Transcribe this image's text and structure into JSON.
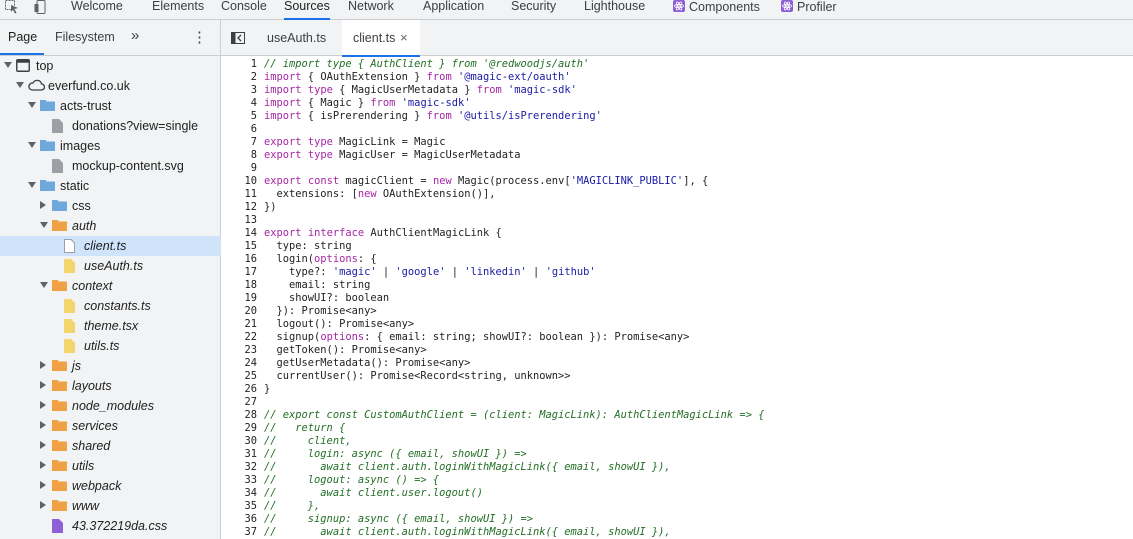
{
  "devtools_tabs": [
    "Welcome",
    "Elements",
    "Console",
    "Sources",
    "Network",
    "Application",
    "Security",
    "Lighthouse",
    "Components",
    "Profiler"
  ],
  "active_tab": "Sources",
  "navigator": {
    "tabs": [
      "Page",
      "Filesystem"
    ],
    "more": "»",
    "menu": "⋮",
    "tree": [
      {
        "label": "top",
        "depth": 0,
        "arrow": "down",
        "icon": "frame",
        "italic": false
      },
      {
        "label": "everfund.co.uk",
        "depth": 1,
        "arrow": "down",
        "icon": "cloud",
        "italic": false
      },
      {
        "label": "acts-trust",
        "depth": 2,
        "arrow": "down",
        "icon": "folder-blue",
        "italic": false
      },
      {
        "label": "donations?view=single",
        "depth": 3,
        "arrow": "",
        "icon": "file-gray",
        "italic": false
      },
      {
        "label": "images",
        "depth": 2,
        "arrow": "down",
        "icon": "folder-blue",
        "italic": false
      },
      {
        "label": "mockup-content.svg",
        "depth": 3,
        "arrow": "",
        "icon": "file-gray",
        "italic": false
      },
      {
        "label": "static",
        "depth": 2,
        "arrow": "down",
        "icon": "folder-blue",
        "italic": false
      },
      {
        "label": "css",
        "depth": 3,
        "arrow": "right",
        "icon": "folder-blue",
        "italic": false
      },
      {
        "label": "auth",
        "depth": 3,
        "arrow": "down",
        "icon": "folder-orange",
        "italic": true
      },
      {
        "label": "client.ts",
        "depth": 4,
        "arrow": "",
        "icon": "file-white",
        "italic": true,
        "selected": true
      },
      {
        "label": "useAuth.ts",
        "depth": 4,
        "arrow": "",
        "icon": "file-yellow",
        "italic": true
      },
      {
        "label": "context",
        "depth": 3,
        "arrow": "down",
        "icon": "folder-orange",
        "italic": true
      },
      {
        "label": "constants.ts",
        "depth": 4,
        "arrow": "",
        "icon": "file-yellow",
        "italic": true
      },
      {
        "label": "theme.tsx",
        "depth": 4,
        "arrow": "",
        "icon": "file-yellow",
        "italic": true
      },
      {
        "label": "utils.ts",
        "depth": 4,
        "arrow": "",
        "icon": "file-yellow",
        "italic": true
      },
      {
        "label": "js",
        "depth": 3,
        "arrow": "right",
        "icon": "folder-orange",
        "italic": true
      },
      {
        "label": "layouts",
        "depth": 3,
        "arrow": "right",
        "icon": "folder-orange",
        "italic": true
      },
      {
        "label": "node_modules",
        "depth": 3,
        "arrow": "right",
        "icon": "folder-orange",
        "italic": true
      },
      {
        "label": "services",
        "depth": 3,
        "arrow": "right",
        "icon": "folder-orange",
        "italic": true
      },
      {
        "label": "shared",
        "depth": 3,
        "arrow": "right",
        "icon": "folder-orange",
        "italic": true
      },
      {
        "label": "utils",
        "depth": 3,
        "arrow": "right",
        "icon": "folder-orange",
        "italic": true
      },
      {
        "label": "webpack",
        "depth": 3,
        "arrow": "right",
        "icon": "folder-orange",
        "italic": true
      },
      {
        "label": "www",
        "depth": 3,
        "arrow": "right",
        "icon": "folder-orange",
        "italic": true
      },
      {
        "label": "43.372219da.css",
        "depth": 3,
        "arrow": "",
        "icon": "file-purple",
        "italic": true
      }
    ]
  },
  "editor": {
    "tabs": [
      {
        "label": "useAuth.ts",
        "active": false
      },
      {
        "label": "client.ts",
        "active": true,
        "closable": true
      }
    ],
    "close_glyph": "×",
    "lines": [
      [
        [
          "c",
          "// import type { AuthClient } from '@redwoodjs/auth'"
        ]
      ],
      [
        [
          "k",
          "import"
        ],
        [
          "t",
          " { OAuthExtension } "
        ],
        [
          "k",
          "from"
        ],
        [
          "t",
          " "
        ],
        [
          "s",
          "'@magic-ext/oauth'"
        ]
      ],
      [
        [
          "k",
          "import"
        ],
        [
          "t",
          " "
        ],
        [
          "k",
          "type"
        ],
        [
          "t",
          " { MagicUserMetadata } "
        ],
        [
          "k",
          "from"
        ],
        [
          "t",
          " "
        ],
        [
          "s",
          "'magic-sdk'"
        ]
      ],
      [
        [
          "k",
          "import"
        ],
        [
          "t",
          " { Magic } "
        ],
        [
          "k",
          "from"
        ],
        [
          "t",
          " "
        ],
        [
          "s",
          "'magic-sdk'"
        ]
      ],
      [
        [
          "k",
          "import"
        ],
        [
          "t",
          " { isPrerendering } "
        ],
        [
          "k",
          "from"
        ],
        [
          "t",
          " "
        ],
        [
          "s",
          "'@utils/isPrerendering'"
        ]
      ],
      [],
      [
        [
          "k",
          "export"
        ],
        [
          "t",
          " "
        ],
        [
          "k",
          "type"
        ],
        [
          "t",
          " MagicLink = Magic"
        ]
      ],
      [
        [
          "k",
          "export"
        ],
        [
          "t",
          " "
        ],
        [
          "k",
          "type"
        ],
        [
          "t",
          " MagicUser = MagicUserMetadata"
        ]
      ],
      [],
      [
        [
          "k",
          "export"
        ],
        [
          "t",
          " "
        ],
        [
          "k",
          "const"
        ],
        [
          "t",
          " magicClient = "
        ],
        [
          "k",
          "new"
        ],
        [
          "t",
          " Magic(process.env["
        ],
        [
          "s",
          "'MAGICLINK_PUBLIC'"
        ],
        [
          "t",
          "], {"
        ]
      ],
      [
        [
          "t",
          "  extensions: ["
        ],
        [
          "k",
          "new"
        ],
        [
          "t",
          " OAuthExtension()],"
        ]
      ],
      [
        [
          "t",
          "})"
        ]
      ],
      [],
      [
        [
          "k",
          "export"
        ],
        [
          "t",
          " "
        ],
        [
          "k",
          "interface"
        ],
        [
          "t",
          " AuthClientMagicLink {"
        ]
      ],
      [
        [
          "t",
          "  type: string"
        ]
      ],
      [
        [
          "t",
          "  login("
        ],
        [
          "k",
          "options"
        ],
        [
          "t",
          ": {"
        ]
      ],
      [
        [
          "t",
          "    type?: "
        ],
        [
          "s",
          "'magic'"
        ],
        [
          "t",
          " | "
        ],
        [
          "s",
          "'google'"
        ],
        [
          "t",
          " | "
        ],
        [
          "s",
          "'linkedin'"
        ],
        [
          "t",
          " | "
        ],
        [
          "s",
          "'github'"
        ]
      ],
      [
        [
          "t",
          "    email: string"
        ]
      ],
      [
        [
          "t",
          "    showUI?: boolean"
        ]
      ],
      [
        [
          "t",
          "  }): Promise<any>"
        ]
      ],
      [
        [
          "t",
          "  logout(): Promise<any>"
        ]
      ],
      [
        [
          "t",
          "  signup("
        ],
        [
          "k",
          "options"
        ],
        [
          "t",
          ": { email: string; showUI?: boolean }): Promise<any>"
        ]
      ],
      [
        [
          "t",
          "  getToken(): Promise<any>"
        ]
      ],
      [
        [
          "t",
          "  getUserMetadata(): Promise<any>"
        ]
      ],
      [
        [
          "t",
          "  currentUser(): Promise<Record<string, unknown>>"
        ]
      ],
      [
        [
          "t",
          "}"
        ]
      ],
      [],
      [
        [
          "c",
          "// export const CustomAuthClient = (client: MagicLink): AuthClientMagicLink => {"
        ]
      ],
      [
        [
          "c",
          "//   return {"
        ]
      ],
      [
        [
          "c",
          "//     client,"
        ]
      ],
      [
        [
          "c",
          "//     login: async ({ email, showUI }) =>"
        ]
      ],
      [
        [
          "c",
          "//       await client.auth.loginWithMagicLink({ email, showUI }),"
        ]
      ],
      [
        [
          "c",
          "//     logout: async () => {"
        ]
      ],
      [
        [
          "c",
          "//       await client.user.logout()"
        ]
      ],
      [
        [
          "c",
          "//     },"
        ]
      ],
      [
        [
          "c",
          "//     signup: async ({ email, showUI }) =>"
        ]
      ],
      [
        [
          "c",
          "//       await client.auth.loginWithMagicLink({ email, showUI }),"
        ]
      ]
    ]
  },
  "colors": {
    "accent": "#1a73e8",
    "keyword": "#a626a4",
    "string": "#1a1aa6",
    "comment": "#236e25",
    "folder_blue": "#6fa8dc",
    "folder_orange": "#f0a045",
    "file_yellow": "#f2d56b",
    "file_gray": "#9aa0a6",
    "file_purple": "#8e5fd6",
    "selection": "#cfe3fb"
  }
}
